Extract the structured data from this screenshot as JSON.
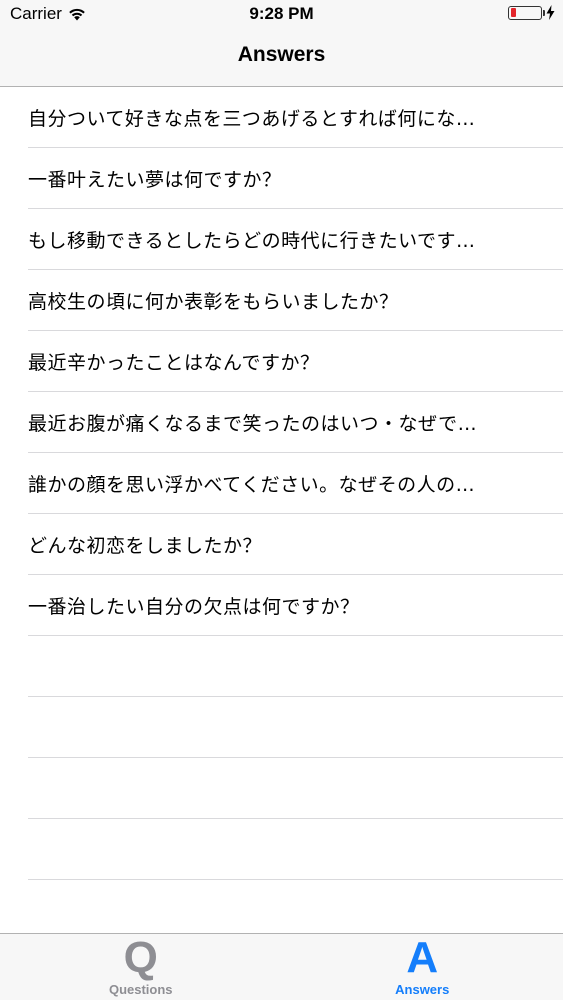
{
  "status_bar": {
    "carrier": "Carrier",
    "time": "9:28 PM",
    "battery_color": "#e3252b"
  },
  "nav": {
    "title": "Answers"
  },
  "list": {
    "items": [
      {
        "label": "自分ついて好きな点を三つあげるとすれば何にな…"
      },
      {
        "label": "一番叶えたい夢は何ですか？"
      },
      {
        "label": "もし移動できるとしたらどの時代に行きたいです…"
      },
      {
        "label": "高校生の頃に何か表彰をもらいましたか？"
      },
      {
        "label": "最近辛かったことはなんですか？"
      },
      {
        "label": "最近お腹が痛くなるまで笑ったのはいつ・なぜで…"
      },
      {
        "label": "誰かの顔を思い浮かべてください。なぜその人の…"
      },
      {
        "label": "どんな初恋をしましたか？"
      },
      {
        "label": "一番治したい自分の欠点は何ですか？"
      }
    ]
  },
  "tabbar": {
    "tabs": [
      {
        "icon": "Q",
        "label": "Questions",
        "active": false
      },
      {
        "icon": "A",
        "label": "Answers",
        "active": true
      }
    ],
    "active_color": "#147efb",
    "inactive_color": "#8e8e93"
  }
}
